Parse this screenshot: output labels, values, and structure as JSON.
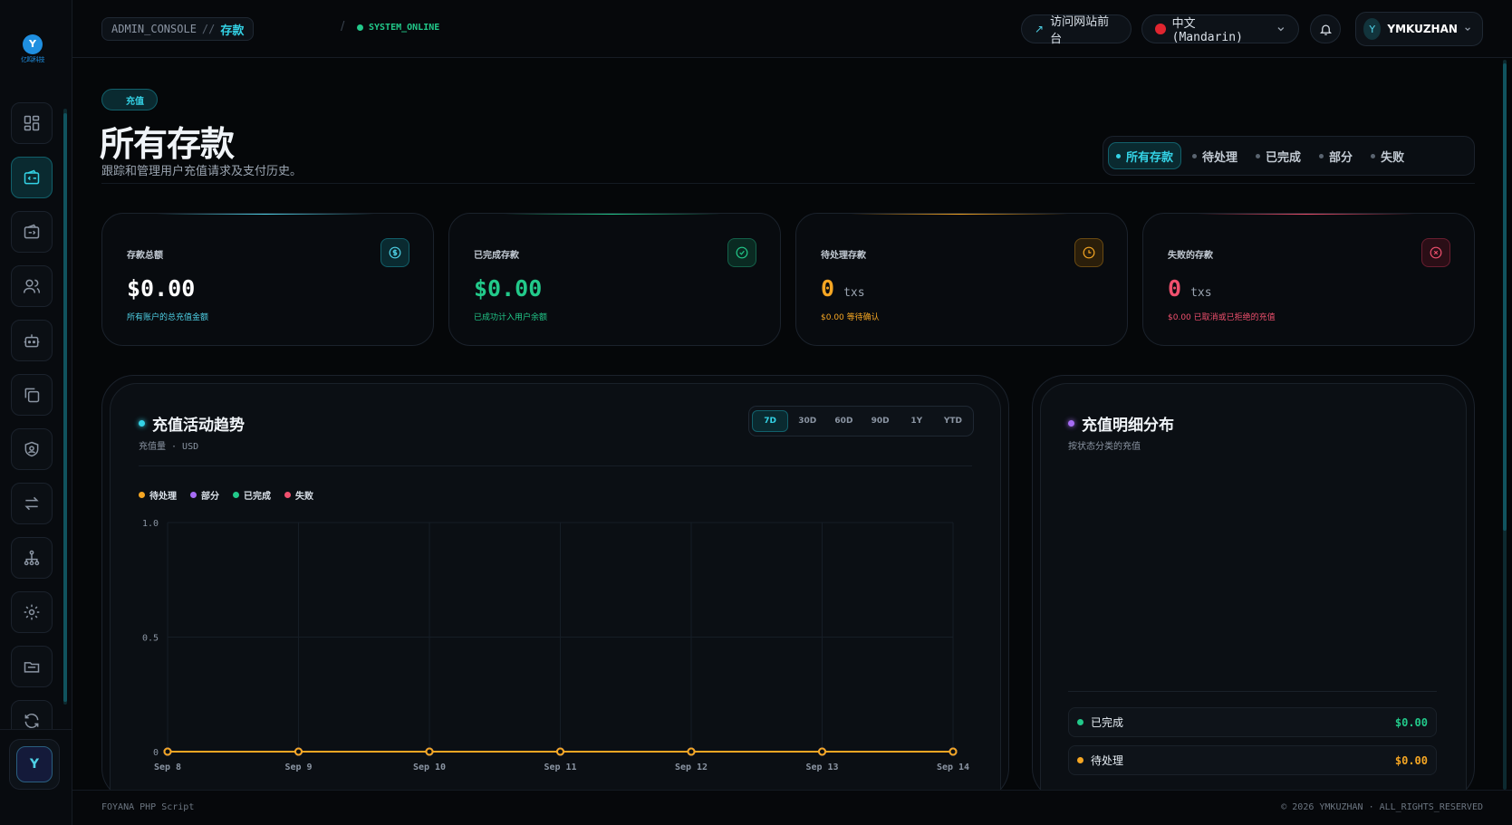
{
  "logo": {
    "text": "亿鸣科技"
  },
  "sidebar": {
    "items": [
      {
        "name": "dashboard-icon"
      },
      {
        "name": "wallet-in-icon",
        "active": true
      },
      {
        "name": "wallet-out-icon"
      },
      {
        "name": "users-icon"
      },
      {
        "name": "bot-icon"
      },
      {
        "name": "copy-icon"
      },
      {
        "name": "shield-icon"
      },
      {
        "name": "transfer-icon"
      },
      {
        "name": "network-icon"
      },
      {
        "name": "gear-icon"
      },
      {
        "name": "folder-icon"
      },
      {
        "name": "refresh-icon"
      }
    ],
    "avatar": "Y"
  },
  "topbar": {
    "crumb_root": "ADMIN_CONSOLE",
    "crumb_sep": "//",
    "crumb_page": "存款",
    "slash": "/",
    "status": "SYSTEM_ONLINE",
    "visit_label": "访问网站前台",
    "lang_label": "中文 (Mandarin)",
    "user_initial": "Y",
    "user_name": "YMKUZHAN"
  },
  "header": {
    "pill": "充值",
    "title": "所有存款",
    "subtitle": "跟踪和管理用户充值请求及支付历史。"
  },
  "filters": [
    "所有存款",
    "待处理",
    "已完成",
    "部分",
    "失败"
  ],
  "stats": [
    {
      "label": "存款总额",
      "value": "$0.00",
      "unit": "",
      "note": "所有账户的总充值金额",
      "color": "#4fd1e6",
      "icon": "dollar-icon"
    },
    {
      "label": "已完成存款",
      "value": "$0.00",
      "unit": "",
      "note": "已成功计入用户余额",
      "color": "#22c98a",
      "icon": "check-circle-icon"
    },
    {
      "label": "待处理存款",
      "value": "0",
      "unit": "txs",
      "note": "$0.00 等待确认",
      "color": "#f5a623",
      "icon": "clock-icon"
    },
    {
      "label": "失败的存款",
      "value": "0",
      "unit": "txs",
      "note": "$0.00 已取消或已拒绝的充值",
      "color": "#f0506e",
      "icon": "x-circle-icon"
    }
  ],
  "trend": {
    "title": "充值活动趋势",
    "subtitle": "充值量 · USD",
    "ranges": [
      "7D",
      "30D",
      "60D",
      "90D",
      "1Y",
      "YTD"
    ],
    "active_range": "7D"
  },
  "distribution": {
    "title": "充值明细分布",
    "subtitle": "按状态分类的充值",
    "rows": [
      {
        "label": "已完成",
        "amount": "$0.00",
        "color": "#22c98a"
      },
      {
        "label": "待处理",
        "amount": "$0.00",
        "color": "#f5a623"
      }
    ]
  },
  "chart_data": {
    "type": "line",
    "x": [
      "Sep 8",
      "Sep 9",
      "Sep 10",
      "Sep 11",
      "Sep 12",
      "Sep 13",
      "Sep 14"
    ],
    "ylim": [
      0,
      1.0
    ],
    "yticks": [
      "0",
      "0.5",
      "1.0"
    ],
    "legend": "top-left",
    "grid": true,
    "series": [
      {
        "name": "待处理",
        "color": "#f5a623",
        "values": [
          0,
          0,
          0,
          0,
          0,
          0,
          0
        ]
      },
      {
        "name": "部分",
        "color": "#a66cf5",
        "values": [
          0,
          0,
          0,
          0,
          0,
          0,
          0
        ]
      },
      {
        "name": "已完成",
        "color": "#22c98a",
        "values": [
          0,
          0,
          0,
          0,
          0,
          0,
          0
        ]
      },
      {
        "name": "失败",
        "color": "#f0506e",
        "values": [
          0,
          0,
          0,
          0,
          0,
          0,
          0
        ]
      }
    ]
  },
  "footer": {
    "left": "FOYANA PHP Script",
    "right": "© 2026 YMKUZHAN · ALL_RIGHTS_RESERVED"
  }
}
